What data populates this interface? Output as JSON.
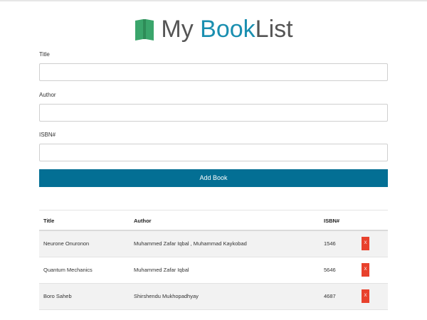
{
  "header": {
    "title_part1": "My ",
    "title_part2": "Book",
    "title_part3": "List",
    "icon": "open-book-icon",
    "icon_color": "#3aa56b",
    "accent_color": "#1a8fb0"
  },
  "form": {
    "title_label": "Title",
    "title_value": "",
    "author_label": "Author",
    "author_value": "",
    "isbn_label": "ISBN#",
    "isbn_value": "",
    "submit_label": "Add Book",
    "submit_color": "#036f94"
  },
  "table": {
    "headers": [
      "Title",
      "Author",
      "ISBN#"
    ],
    "rows": [
      {
        "title": "Neurone Onuronon",
        "author": "Muhammed Zafar Iqbal , Muhammad Kaykobad",
        "isbn": "1546",
        "delete_label": "X"
      },
      {
        "title": "Quantum Mechanics",
        "author": "Muhammed Zafar Iqbal",
        "isbn": "5646",
        "delete_label": "X"
      },
      {
        "title": "Boro Saheb",
        "author": "Shirshendu Mukhopadhyay",
        "isbn": "4687",
        "delete_label": "X"
      }
    ],
    "delete_color": "#e8412c"
  }
}
